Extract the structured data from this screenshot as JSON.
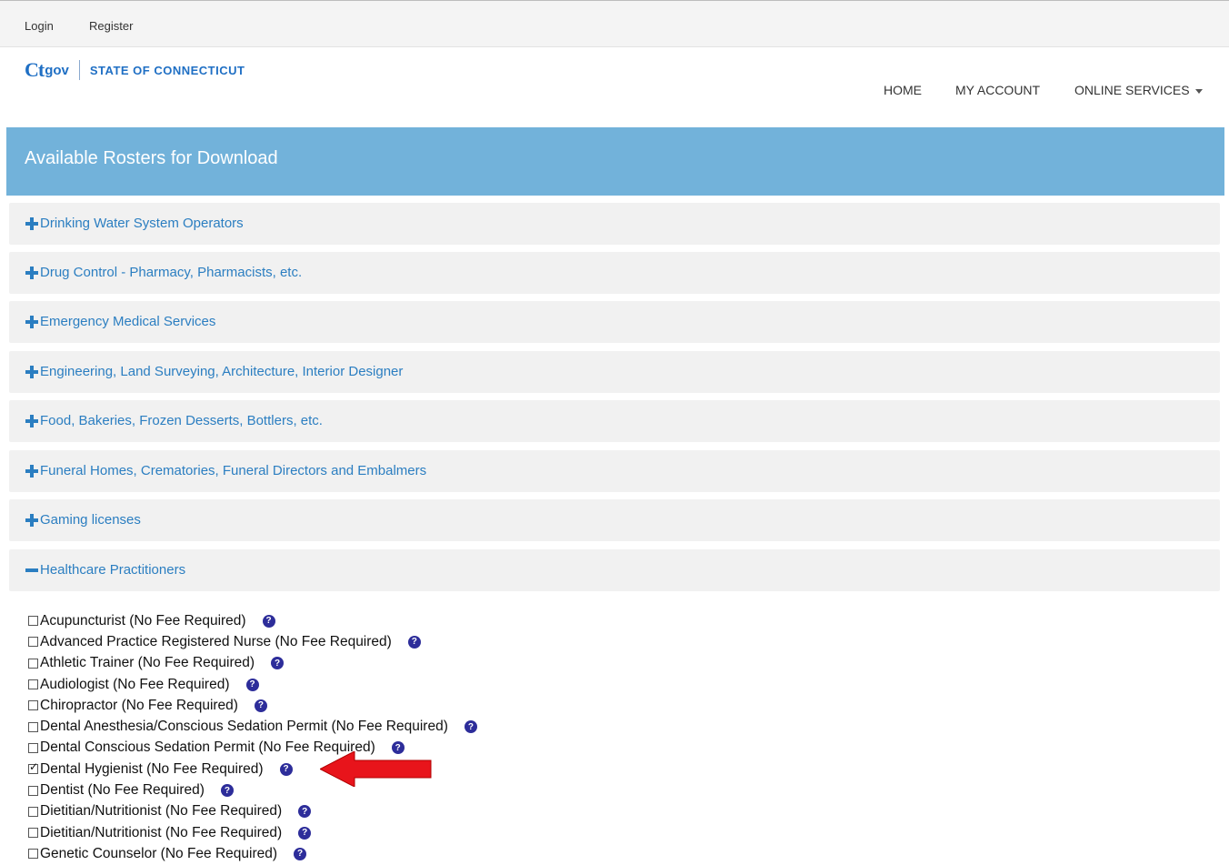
{
  "top_links": {
    "login": "Login",
    "register": "Register"
  },
  "brand": {
    "logo": "Ct",
    "gov": "gov",
    "state": "STATE OF CONNECTICUT"
  },
  "nav": {
    "home": "HOME",
    "my_account": "MY ACCOUNT",
    "online_services": "ONLINE SERVICES"
  },
  "page_title": "Available Rosters for Download",
  "categories": [
    {
      "label": "Drinking Water System Operators",
      "expanded": false
    },
    {
      "label": "Drug Control - Pharmacy, Pharmacists, etc.",
      "expanded": false
    },
    {
      "label": "Emergency Medical Services",
      "expanded": false
    },
    {
      "label": "Engineering, Land Surveying, Architecture, Interior Designer",
      "expanded": false
    },
    {
      "label": "Food, Bakeries, Frozen Desserts, Bottlers, etc.",
      "expanded": false
    },
    {
      "label": "Funeral Homes, Crematories, Funeral Directors and Embalmers",
      "expanded": false
    },
    {
      "label": "Gaming licenses",
      "expanded": false
    },
    {
      "label": "Healthcare Practitioners",
      "expanded": true
    }
  ],
  "rosters": [
    {
      "label": "Acupuncturist (No Fee Required)",
      "checked": false
    },
    {
      "label": "Advanced Practice Registered Nurse (No Fee Required)",
      "checked": false
    },
    {
      "label": "Athletic Trainer (No Fee Required)",
      "checked": false
    },
    {
      "label": "Audiologist (No Fee Required)",
      "checked": false
    },
    {
      "label": "Chiropractor (No Fee Required)",
      "checked": false
    },
    {
      "label": "Dental Anesthesia/Conscious Sedation Permit (No Fee Required)",
      "checked": false
    },
    {
      "label": "Dental Conscious Sedation Permit (No Fee Required)",
      "checked": false
    },
    {
      "label": "Dental Hygienist (No Fee Required)",
      "checked": true
    },
    {
      "label": "Dentist (No Fee Required)",
      "checked": false
    },
    {
      "label": "Dietitian/Nutritionist (No Fee Required)",
      "checked": false
    },
    {
      "label": "Dietitian/Nutritionist (No Fee Required)",
      "checked": false
    },
    {
      "label": "Genetic Counselor (No Fee Required)",
      "checked": false
    }
  ],
  "help_glyph": "?",
  "colors": {
    "banner": "#72b2da",
    "link": "#2b7ec1",
    "arrow": "#e8141b"
  }
}
